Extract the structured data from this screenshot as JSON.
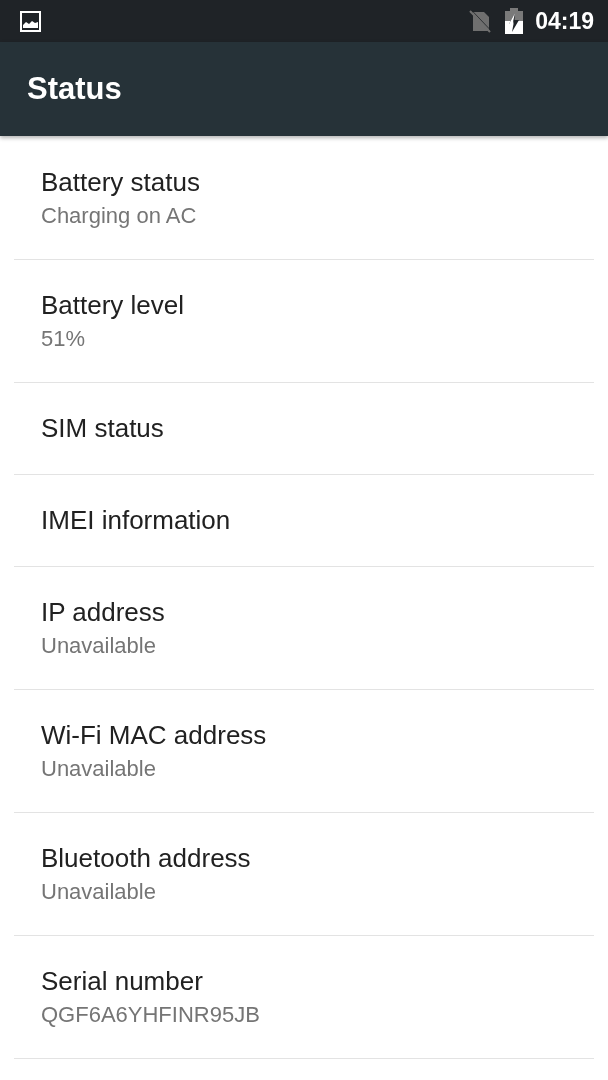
{
  "status_bar": {
    "time": "04:19"
  },
  "app_bar": {
    "title": "Status"
  },
  "items": [
    {
      "title": "Battery status",
      "summary": "Charging on AC"
    },
    {
      "title": "Battery level",
      "summary": "51%"
    },
    {
      "title": "SIM status"
    },
    {
      "title": "IMEI information"
    },
    {
      "title": "IP address",
      "summary": "Unavailable"
    },
    {
      "title": "Wi-Fi MAC address",
      "summary": "Unavailable"
    },
    {
      "title": "Bluetooth address",
      "summary": "Unavailable"
    },
    {
      "title": "Serial number",
      "summary": "QGF6A6YHFINR95JB"
    }
  ]
}
